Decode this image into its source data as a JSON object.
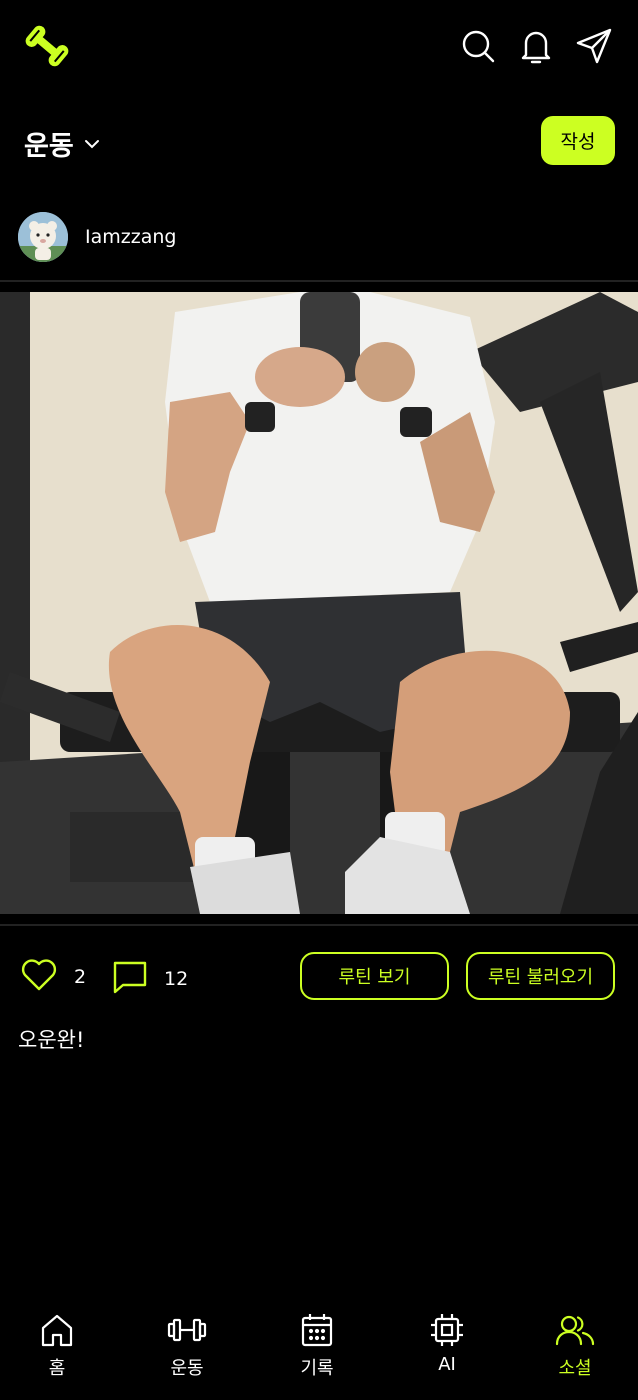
{
  "header": {
    "logo_icon": "dumbbell-logo-icon",
    "icons": [
      "search-icon",
      "bell-icon",
      "send-icon"
    ]
  },
  "category": {
    "label": "운동",
    "icon": "chevron-down-icon"
  },
  "write_button": "작성",
  "post": {
    "username": "Iamzzang",
    "likes": "2",
    "comments": "12",
    "view_routine": "루틴 보기",
    "load_routine": "루틴 불러오기",
    "caption": "오운완!"
  },
  "nav": {
    "items": [
      {
        "label": "홈",
        "icon": "home-icon"
      },
      {
        "label": "운동",
        "icon": "dumbbell-icon"
      },
      {
        "label": "기록",
        "icon": "calendar-icon"
      },
      {
        "label": "AI",
        "icon": "chip-icon"
      },
      {
        "label": "소셜",
        "icon": "users-icon"
      }
    ],
    "active": "소셜"
  },
  "colors": {
    "accent": "#ccff22",
    "background": "#000000"
  }
}
